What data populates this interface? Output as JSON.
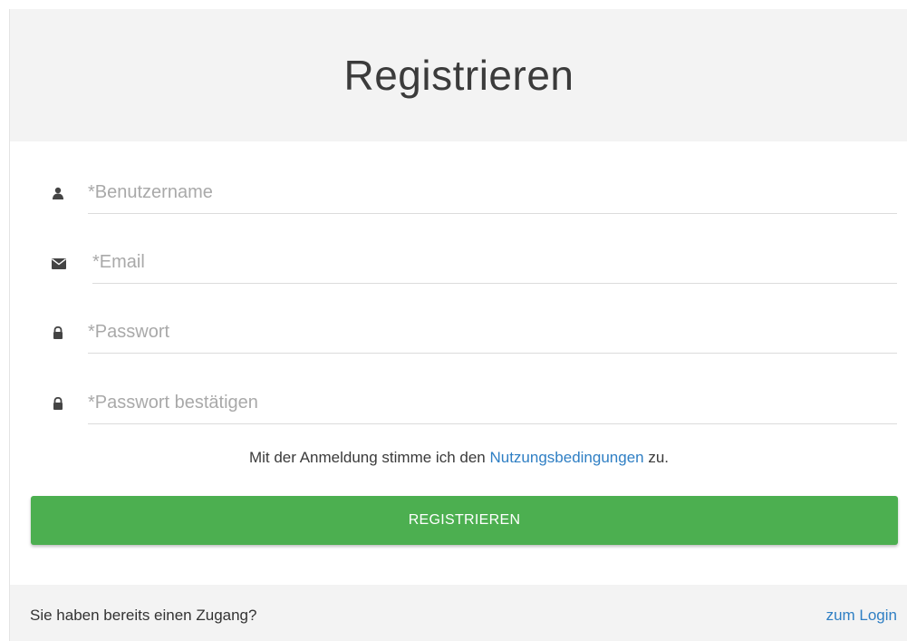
{
  "header": {
    "title": "Registrieren"
  },
  "form": {
    "fields": [
      {
        "name": "username",
        "placeholder": "*Benutzername",
        "icon": "user-icon"
      },
      {
        "name": "email",
        "placeholder": "*Email",
        "icon": "envelope-icon"
      },
      {
        "name": "password",
        "placeholder": "*Passwort",
        "icon": "lock-icon"
      },
      {
        "name": "password_confirm",
        "placeholder": "*Passwort bestätigen",
        "icon": "lock-icon"
      }
    ],
    "terms_prefix": "Mit der Anmeldung stimme ich den ",
    "terms_link": "Nutzungsbedingungen",
    "terms_suffix": " zu.",
    "submit_label": "REGISTRIEREN"
  },
  "footer": {
    "question": "Sie haben bereits einen Zugang?",
    "login_link": "zum Login"
  },
  "colors": {
    "accent_button": "#4caf50",
    "link": "#2f7fc4",
    "header_bg": "#f3f3f3"
  }
}
